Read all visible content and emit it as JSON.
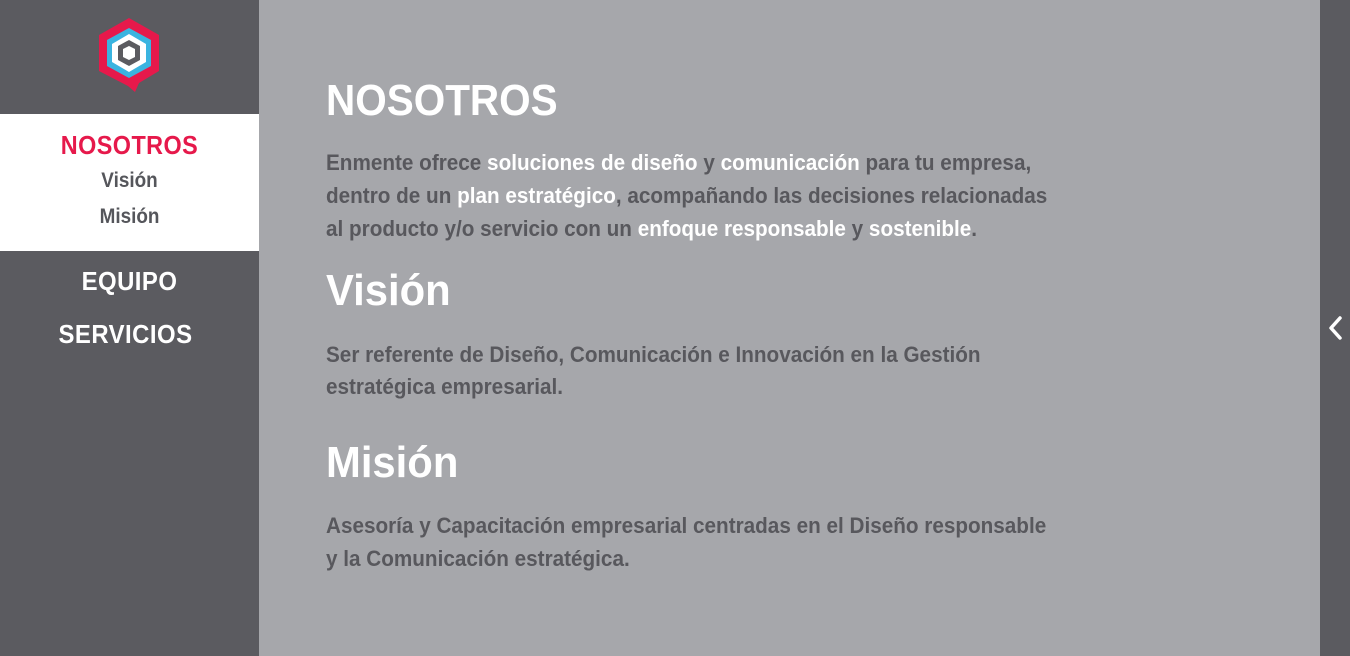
{
  "nav": {
    "active": "NOSOTROS",
    "sub_items": [
      "Visión",
      "Misión"
    ],
    "items": [
      "EQUIPO",
      "SERVICIOS"
    ]
  },
  "about": {
    "title": "NOSOTROS",
    "text": [
      [
        "Enmente ofrece ",
        "n"
      ],
      [
        "soluciones de diseño",
        "h"
      ],
      [
        " y ",
        "n"
      ],
      [
        "comunicación",
        "h"
      ],
      [
        " para tu empresa,",
        "n"
      ]
    ]
  },
  "about_lines": {
    "l1": {
      "a": "Enmente ofrece ",
      "b": "soluciones de diseño",
      "c": " y ",
      "d": "comunicación",
      "e": " para tu empresa,"
    },
    "l2": {
      "a": "dentro de un ",
      "b": "plan estratégico",
      "c": ", acompañando las decisiones relacionadas"
    },
    "l3": {
      "a": "al producto y/o servicio con un ",
      "b": "enfoque responsable",
      "c": " y ",
      "d": "sostenible",
      "e": "."
    }
  },
  "vision": {
    "title": "Visión",
    "line1": "Ser referente de Diseño, Comunicación e Innovación en la Gestión",
    "line2": "estratégica empresarial."
  },
  "mision": {
    "title": "Misión",
    "line1": "Asesoría y Capacitación empresarial centradas en el Diseño responsable",
    "line2": "y la Comunicación estratégica."
  },
  "colors": {
    "accent": "#e6194b",
    "sidebar": "#5b5b60",
    "content_bg": "#a6a7ab",
    "logo_blue": "#3ab4e0"
  },
  "icons": {
    "logo": "enmente-hexagon-logo",
    "toggle": "chevron-left-icon"
  }
}
